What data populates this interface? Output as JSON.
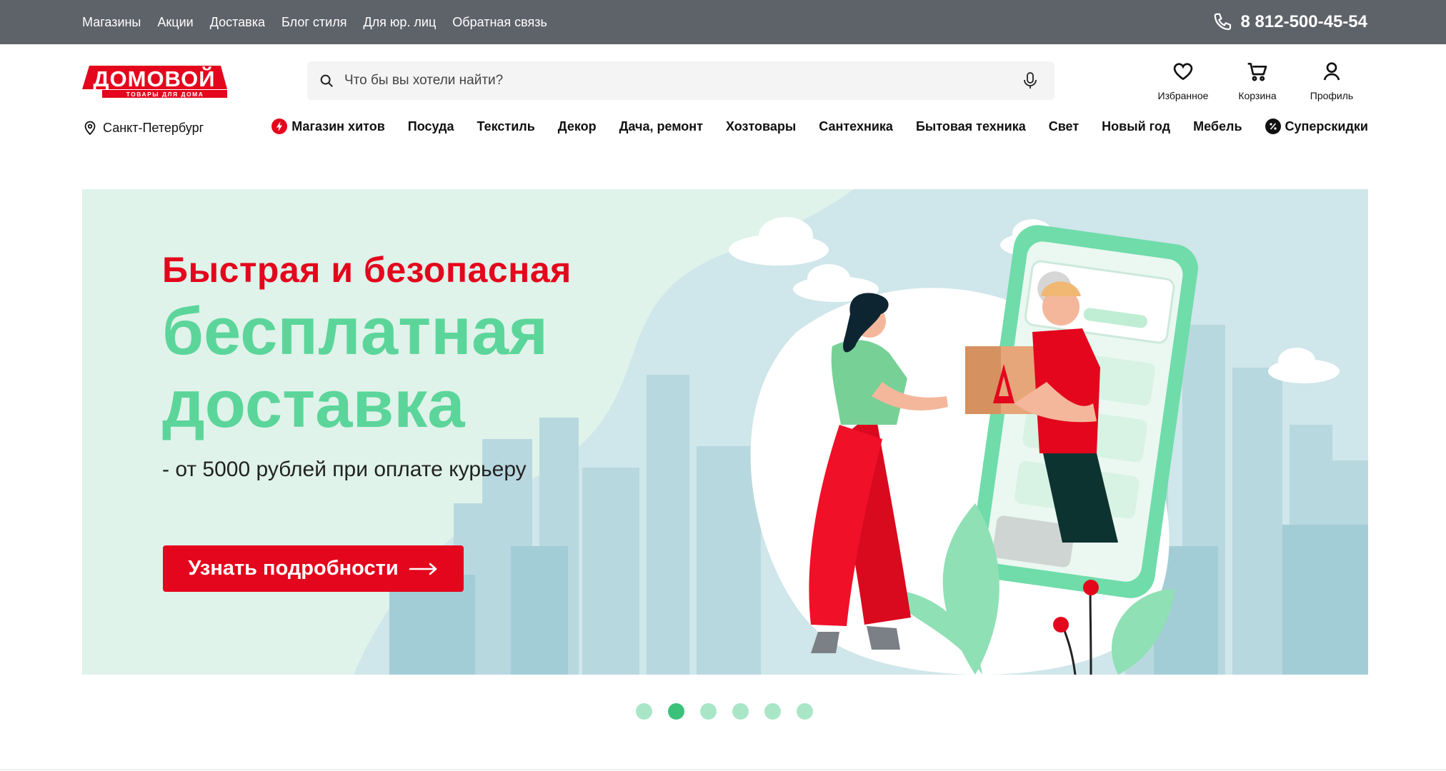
{
  "topbar": {
    "links": [
      "Магазины",
      "Акции",
      "Доставка",
      "Блог стиля",
      "Для юр. лиц",
      "Обратная связь"
    ],
    "phone": "8 812-500-45-54"
  },
  "header": {
    "logo_text": "ДОМОВОЙ",
    "logo_tagline": "ТОВАРЫ ДЛЯ ДОМА",
    "search_placeholder": "Что бы вы хотели найти?",
    "actions": {
      "favorites": "Избранное",
      "cart": "Корзина",
      "profile": "Профиль"
    }
  },
  "nav": {
    "city": "Санкт-Петербург",
    "categories": [
      "Магазин хитов",
      "Посуда",
      "Текстиль",
      "Декор",
      "Дача, ремонт",
      "Хозтовары",
      "Сантехника",
      "Бытовая техника",
      "Свет",
      "Новый год",
      "Мебель",
      "Суперскидки"
    ]
  },
  "banner": {
    "line1": "Быстрая и безопасная",
    "line2": "бесплатная",
    "line3": "доставка",
    "subtitle": "- от 5000 рублей при оплате курьеру",
    "button": "Узнать подробности"
  },
  "carousel": {
    "count": 6,
    "active_index": 1
  },
  "colors": {
    "brand_red": "#e4061c",
    "accent_green": "#5cd59a",
    "topbar_bg": "#5e6269",
    "dot_active": "#3cc17a",
    "dot": "#a8e6c7"
  }
}
